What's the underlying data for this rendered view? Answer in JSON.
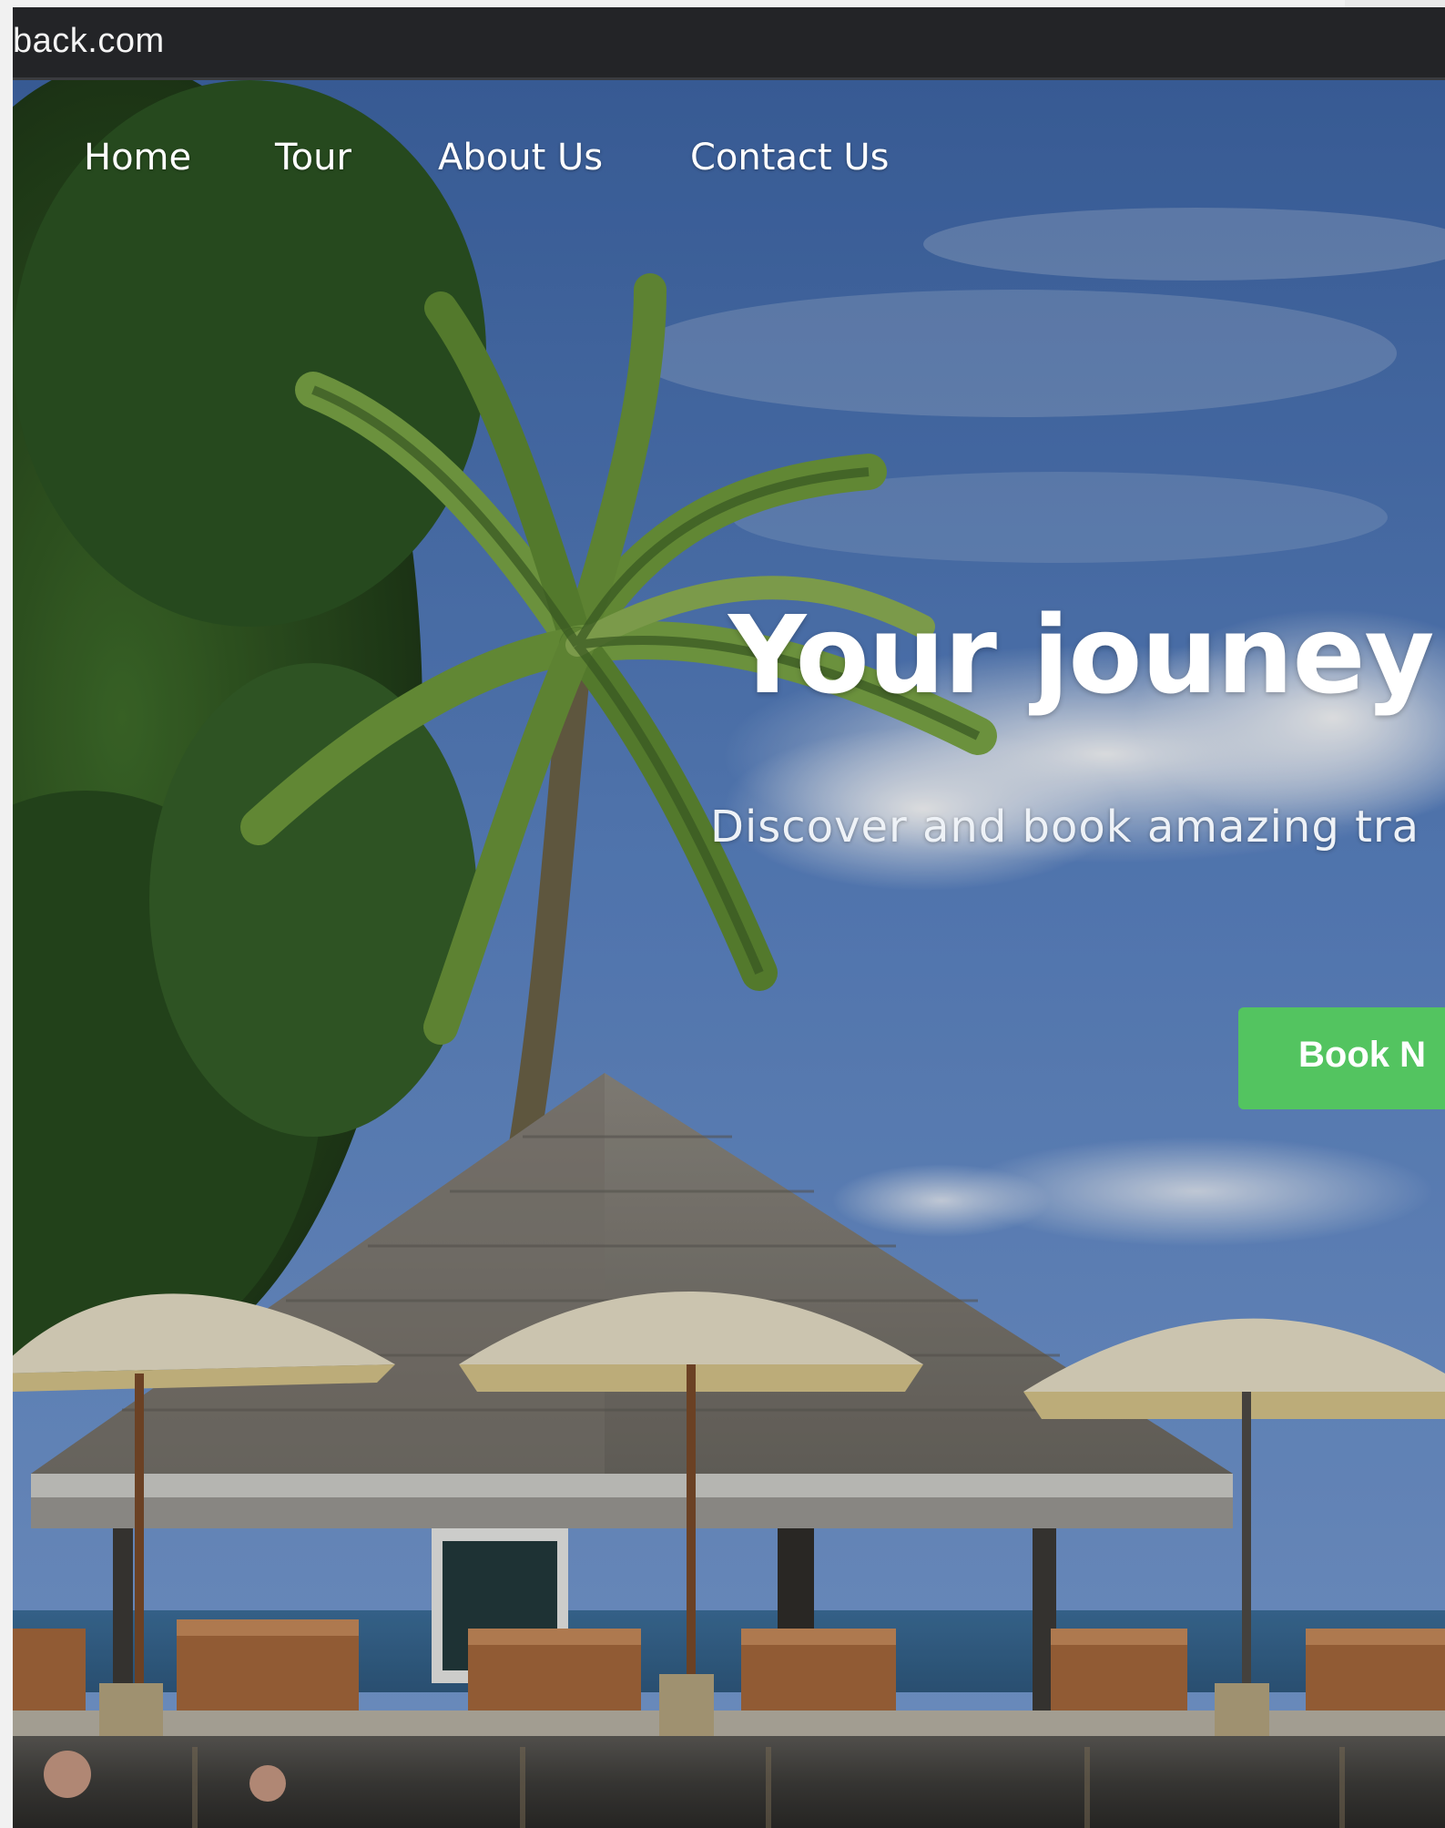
{
  "browser": {
    "url": "back.com"
  },
  "nav": {
    "items": [
      {
        "label": "Home"
      },
      {
        "label": "Tour"
      },
      {
        "label": "About Us"
      },
      {
        "label": "Contact Us"
      }
    ]
  },
  "hero": {
    "title": "Your jouney",
    "subtitle": "Discover and book amazing tra",
    "cta_label": "Book N",
    "cta_color": "#53c460",
    "background_image": "tropical-resort-photo"
  }
}
